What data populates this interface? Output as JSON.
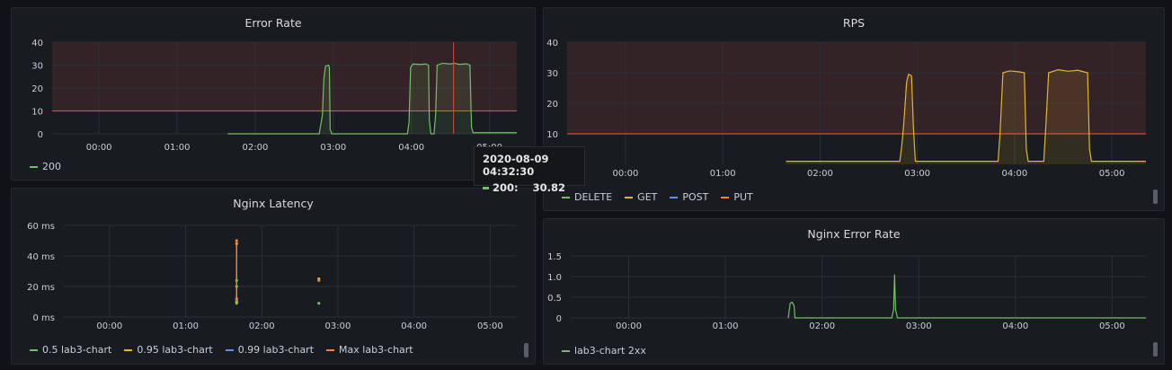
{
  "colors": {
    "green": "#73bf69",
    "yellow": "#e5b42e",
    "blue": "#5794f2",
    "orange": "#ff7d43",
    "threshold": "#d44a3a",
    "grid": "#2c3037",
    "tick": "#c7d0d9",
    "threshold_fill": "#3a2428"
  },
  "tooltip": {
    "time": "2020-08-09 04:32:30",
    "series": "200:",
    "value": "30.82"
  },
  "chart_data": [
    {
      "type": "area",
      "title": "Error Rate",
      "x_ticks": [
        "00:00",
        "01:00",
        "02:00",
        "03:00",
        "04:00",
        "05:00"
      ],
      "xlim_hours": [
        -0.6,
        5.35
      ],
      "ylim": [
        0,
        40
      ],
      "y_ticks": [
        0,
        10,
        20,
        30,
        40
      ],
      "threshold": 10,
      "grid": true,
      "legend_position": "bottom-left",
      "series": [
        {
          "name": "200",
          "color_key": "green",
          "points": [
            [
              1.65,
              0
            ],
            [
              2.82,
              0
            ],
            [
              2.83,
              2
            ],
            [
              2.86,
              8
            ],
            [
              2.88,
              24
            ],
            [
              2.9,
              29.5
            ],
            [
              2.94,
              30
            ],
            [
              2.95,
              29
            ],
            [
              2.96,
              2
            ],
            [
              2.98,
              0
            ],
            [
              3.95,
              0
            ],
            [
              3.97,
              5
            ],
            [
              3.99,
              29
            ],
            [
              4.02,
              30.5
            ],
            [
              4.12,
              30.3
            ],
            [
              4.18,
              30.5
            ],
            [
              4.22,
              30
            ],
            [
              4.23,
              6
            ],
            [
              4.25,
              0
            ],
            [
              4.29,
              0
            ],
            [
              4.31,
              8
            ],
            [
              4.33,
              30
            ],
            [
              4.4,
              30.8
            ],
            [
              4.5,
              30.5
            ],
            [
              4.55,
              30.8
            ],
            [
              4.62,
              30.3
            ],
            [
              4.7,
              30.6
            ],
            [
              4.75,
              30
            ],
            [
              4.77,
              3
            ],
            [
              4.79,
              0.5
            ],
            [
              5.35,
              0.5
            ]
          ]
        }
      ],
      "cursor_hour": 4.54
    },
    {
      "type": "area",
      "title": "RPS",
      "x_ticks": [
        "00:00",
        "01:00",
        "02:00",
        "03:00",
        "04:00",
        "05:00"
      ],
      "xlim_hours": [
        -0.6,
        5.35
      ],
      "ylim": [
        0,
        40
      ],
      "y_ticks": [
        10,
        20,
        30,
        40
      ],
      "threshold": 10,
      "grid": true,
      "legend_position": "bottom-left",
      "series": [
        {
          "name": "DELETE",
          "color_key": "green",
          "points": []
        },
        {
          "name": "GET",
          "color_key": "yellow",
          "points": [
            [
              1.65,
              1
            ],
            [
              2.82,
              1
            ],
            [
              2.84,
              6
            ],
            [
              2.86,
              13
            ],
            [
              2.89,
              27
            ],
            [
              2.91,
              29.5
            ],
            [
              2.94,
              29
            ],
            [
              2.96,
              12
            ],
            [
              2.98,
              1
            ],
            [
              3.83,
              1
            ],
            [
              3.85,
              10
            ],
            [
              3.88,
              30
            ],
            [
              3.95,
              30.6
            ],
            [
              4.05,
              30.3
            ],
            [
              4.1,
              30
            ],
            [
              4.12,
              5
            ],
            [
              4.14,
              1
            ],
            [
              4.3,
              1
            ],
            [
              4.32,
              12
            ],
            [
              4.35,
              30
            ],
            [
              4.45,
              31
            ],
            [
              4.55,
              30.5
            ],
            [
              4.65,
              30.8
            ],
            [
              4.75,
              30
            ],
            [
              4.77,
              5
            ],
            [
              4.79,
              1
            ],
            [
              5.35,
              1
            ]
          ]
        },
        {
          "name": "POST",
          "color_key": "blue",
          "points": []
        },
        {
          "name": "PUT",
          "color_key": "orange",
          "points": []
        }
      ]
    },
    {
      "type": "line",
      "title": "Nginx Latency",
      "x_ticks": [
        "00:00",
        "01:00",
        "02:00",
        "03:00",
        "04:00",
        "05:00"
      ],
      "xlim_hours": [
        -0.6,
        5.35
      ],
      "ylim_ms": [
        0,
        60
      ],
      "y_ticks": [
        "0 ms",
        "20 ms",
        "40 ms",
        "60 ms"
      ],
      "y_tick_values": [
        0,
        20,
        40,
        60
      ],
      "grid": true,
      "legend_position": "bottom-left",
      "series": [
        {
          "name": "0.5 lab3-chart",
          "color_key": "green",
          "points": [
            [
              1.67,
              9
            ],
            [
              1.67,
              20
            ],
            [
              1.67,
              24
            ],
            [
              2.75,
              9
            ]
          ]
        },
        {
          "name": "0.95 lab3-chart",
          "color_key": "yellow",
          "points": [
            [
              1.67,
              10
            ],
            [
              1.67,
              48
            ],
            [
              2.75,
              25
            ]
          ]
        },
        {
          "name": "0.99 lab3-chart",
          "color_key": "blue",
          "points": [
            [
              1.67,
              11
            ]
          ]
        },
        {
          "name": "Max lab3-chart",
          "color_key": "orange",
          "points": [
            [
              1.67,
              12
            ],
            [
              1.67,
              50
            ],
            [
              2.75,
              24
            ]
          ]
        }
      ]
    },
    {
      "type": "line",
      "title": "Nginx Error Rate",
      "x_ticks": [
        "00:00",
        "01:00",
        "02:00",
        "03:00",
        "04:00",
        "05:00"
      ],
      "xlim_hours": [
        -0.6,
        5.35
      ],
      "ylim": [
        0,
        1.5
      ],
      "y_ticks": [
        "0",
        "0.5",
        "1.0",
        "1.5"
      ],
      "y_tick_values": [
        0,
        0.5,
        1.0,
        1.5
      ],
      "grid": true,
      "legend_position": "bottom-left",
      "series": [
        {
          "name": "lab3-chart 2xx",
          "color_key": "green",
          "points": [
            [
              1.65,
              0
            ],
            [
              1.67,
              0.35
            ],
            [
              1.69,
              0.38
            ],
            [
              1.71,
              0.3
            ],
            [
              1.72,
              0
            ],
            [
              2.72,
              0
            ],
            [
              2.74,
              0.2
            ],
            [
              2.75,
              1.05
            ],
            [
              2.76,
              0.2
            ],
            [
              2.78,
              0
            ],
            [
              5.35,
              0
            ]
          ]
        }
      ]
    }
  ]
}
